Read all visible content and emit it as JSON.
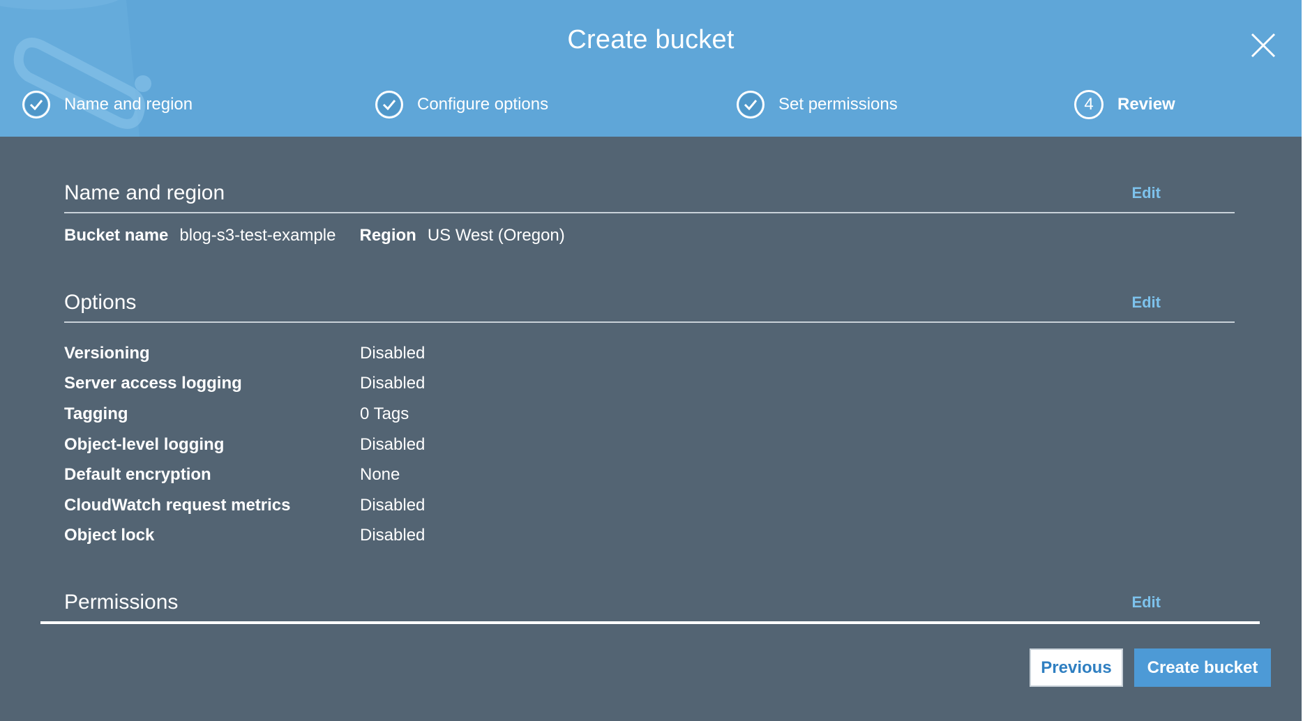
{
  "dialog": {
    "title": "Create bucket"
  },
  "steps": [
    {
      "label": "Name and region",
      "state": "complete",
      "icon": "check-icon"
    },
    {
      "label": "Configure options",
      "state": "complete",
      "icon": "check-icon"
    },
    {
      "label": "Set permissions",
      "state": "complete",
      "icon": "check-icon"
    },
    {
      "label": "Review",
      "state": "active",
      "number": "4"
    }
  ],
  "sections": {
    "name_region": {
      "title": "Name and region",
      "edit_label": "Edit",
      "bucket_name_label": "Bucket name",
      "bucket_name_value": "blog-s3-test-example",
      "region_label": "Region",
      "region_value": "US West (Oregon)"
    },
    "options": {
      "title": "Options",
      "edit_label": "Edit",
      "rows": [
        {
          "label": "Versioning",
          "value": "Disabled"
        },
        {
          "label": "Server access logging",
          "value": "Disabled"
        },
        {
          "label": "Tagging",
          "value": "0 Tags"
        },
        {
          "label": "Object-level logging",
          "value": "Disabled"
        },
        {
          "label": "Default encryption",
          "value": "None"
        },
        {
          "label": "CloudWatch request metrics",
          "value": "Disabled"
        },
        {
          "label": "Object lock",
          "value": "Disabled"
        }
      ]
    },
    "permissions": {
      "title": "Permissions",
      "edit_label": "Edit"
    }
  },
  "footer": {
    "previous_label": "Previous",
    "create_label": "Create bucket"
  },
  "colors": {
    "header_bg": "#5fa6d8",
    "body_bg": "#536473",
    "link": "#7dc2ec",
    "primary_button": "#4d9ad6"
  }
}
